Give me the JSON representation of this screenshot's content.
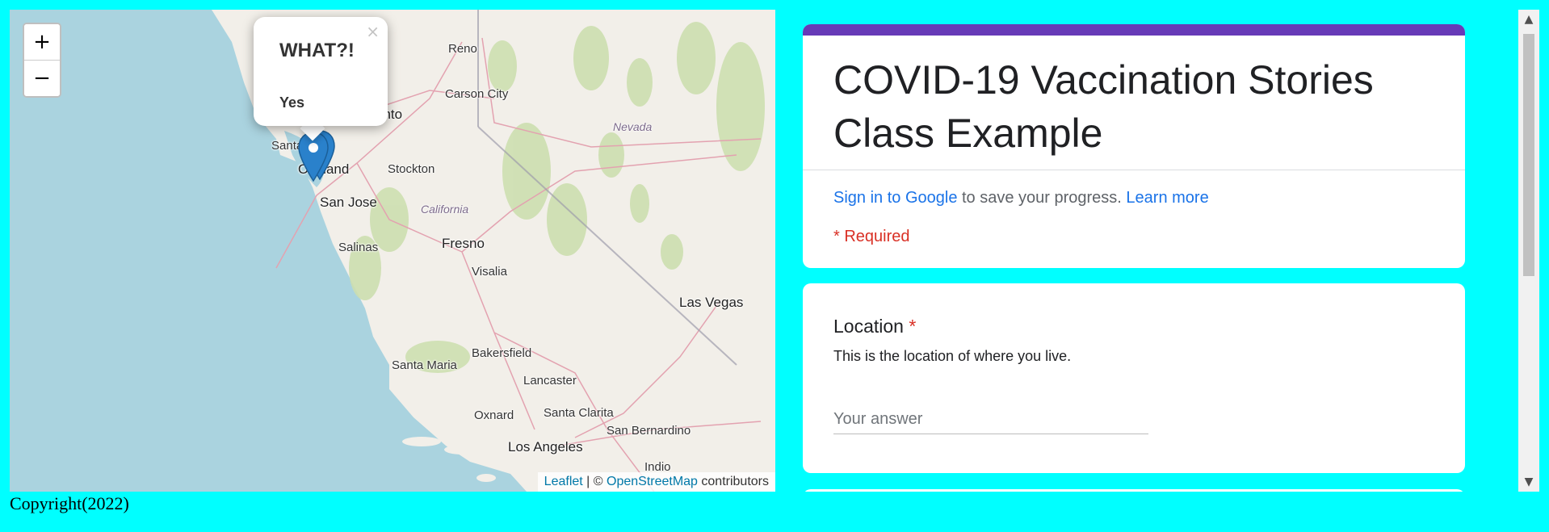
{
  "map": {
    "zoom_in_label": "+",
    "zoom_out_label": "−",
    "popup": {
      "title": "WHAT?!",
      "body": "Yes",
      "close_label": "×"
    },
    "places": [
      {
        "name": "Reno",
        "kind": "city"
      },
      {
        "name": "Carson City",
        "kind": "city"
      },
      {
        "name": "ento",
        "kind": "city"
      },
      {
        "name": "Nevada",
        "kind": "state"
      },
      {
        "name": "Santa",
        "kind": "city"
      },
      {
        "name": "Oakland",
        "kind": "city"
      },
      {
        "name": "Stockton",
        "kind": "city"
      },
      {
        "name": "San Jose",
        "kind": "big"
      },
      {
        "name": "California",
        "kind": "state"
      },
      {
        "name": "Fresno",
        "kind": "big"
      },
      {
        "name": "Salinas",
        "kind": "city"
      },
      {
        "name": "Visalia",
        "kind": "city"
      },
      {
        "name": "Las Vegas",
        "kind": "big"
      },
      {
        "name": "Bakersfield",
        "kind": "city"
      },
      {
        "name": "Santa Maria",
        "kind": "city"
      },
      {
        "name": "Lancaster",
        "kind": "city"
      },
      {
        "name": "Oxnard",
        "kind": "city"
      },
      {
        "name": "Santa Clarita",
        "kind": "city"
      },
      {
        "name": "San Bernardino",
        "kind": "city"
      },
      {
        "name": "Los Angeles",
        "kind": "big"
      },
      {
        "name": "Indio",
        "kind": "city"
      }
    ],
    "attribution": {
      "leaflet": "Leaflet",
      "separator": " | © ",
      "osm": "OpenStreetMap",
      "suffix": " contributors"
    },
    "colors": {
      "water": "#aad3df",
      "land": "#f2efe9",
      "green": "#cddfb0",
      "accent": "#2a81cb"
    }
  },
  "form": {
    "title": "COVID-19 Vaccination Stories Class Example",
    "signin_link": "Sign in to Google",
    "signin_text": " to save your progress. ",
    "learn_more": "Learn more",
    "required_note": "* Required",
    "question": {
      "label": "Location",
      "required_star": " *",
      "description": "This is the location of where you live.",
      "placeholder": "Your answer"
    },
    "colors": {
      "accent": "#673ab7",
      "link": "#1a73e8",
      "required": "#d93025"
    }
  },
  "scrollbar": {
    "up_icon": "▲",
    "down_icon": "▼"
  },
  "footer": {
    "copyright": "Copyright(2022)"
  }
}
